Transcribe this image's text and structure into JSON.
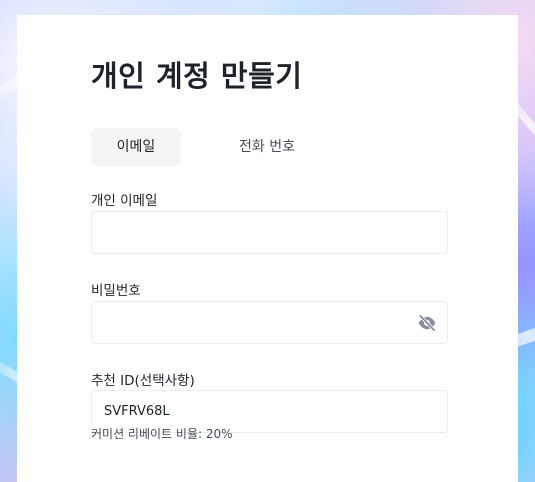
{
  "page": {
    "title": "개인 계정 만들기"
  },
  "tabs": [
    {
      "label": "이메일",
      "selected": true
    },
    {
      "label": "전화 번호",
      "selected": false
    }
  ],
  "form": {
    "email": {
      "label": "개인 이메일",
      "value": ""
    },
    "password": {
      "label": "비밀번호",
      "value": "",
      "toggle_icon": "eye-slash-icon"
    },
    "referral": {
      "label": "추천 ID(선택사항)",
      "value": "SVFRV68L"
    },
    "commission_hint": "커미션 리베이트 비율: 20%"
  },
  "colors": {
    "card_background": "#ffffff",
    "text_primary": "#1e2329",
    "text_secondary": "#474d57",
    "tab_selected_background": "#f5f5f5",
    "input_border": "#eaecef",
    "icon": "#848e9c"
  }
}
